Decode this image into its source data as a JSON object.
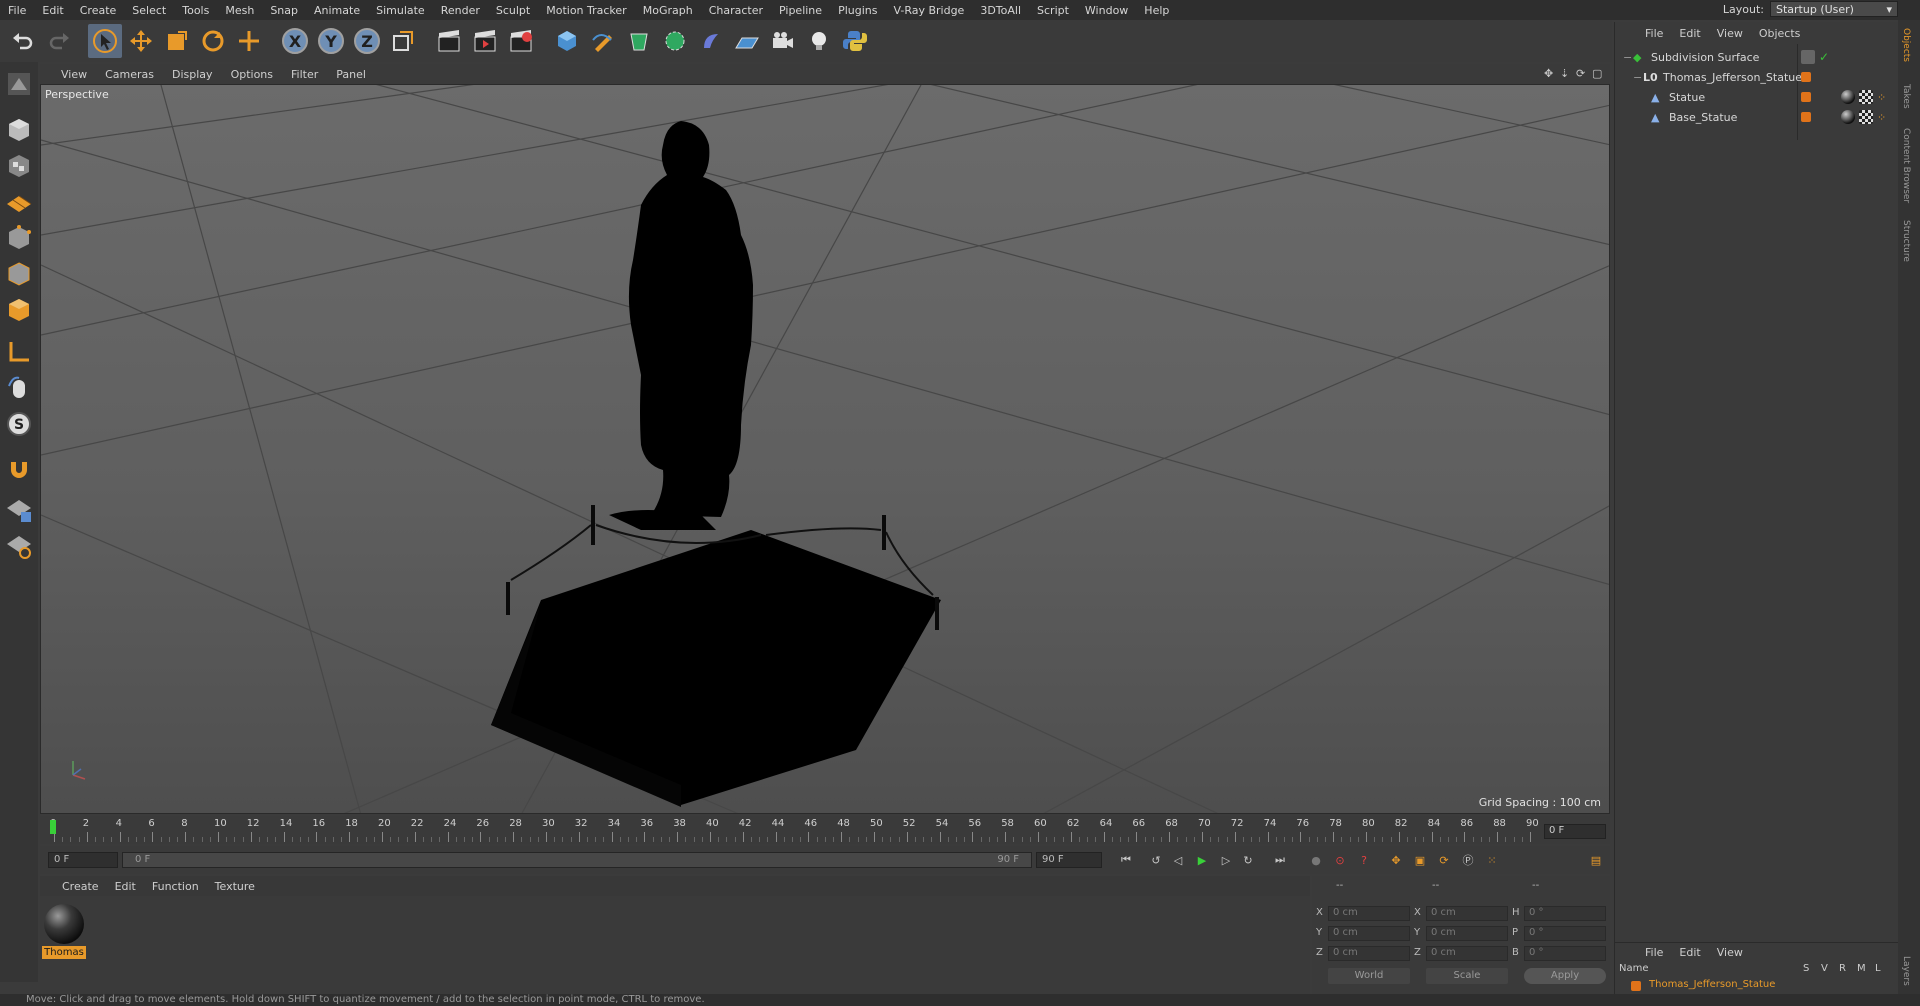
{
  "menubar": [
    "File",
    "Edit",
    "Create",
    "Select",
    "Tools",
    "Mesh",
    "Snap",
    "Animate",
    "Simulate",
    "Render",
    "Sculpt",
    "Motion Tracker",
    "MoGraph",
    "Character",
    "Pipeline",
    "Plugins",
    "V-Ray Bridge",
    "3DToAll",
    "Script",
    "Window",
    "Help"
  ],
  "layout": {
    "label": "Layout:",
    "value": "Startup (User)"
  },
  "viewport": {
    "menu": [
      "View",
      "Cameras",
      "Display",
      "Options",
      "Filter",
      "Panel"
    ],
    "camera_label": "Perspective",
    "grid_spacing": "Grid Spacing : 100 cm"
  },
  "timeline": {
    "ticks": [
      "0",
      "2",
      "4",
      "6",
      "8",
      "10",
      "12",
      "14",
      "16",
      "18",
      "20",
      "22",
      "24",
      "26",
      "28",
      "30",
      "32",
      "34",
      "36",
      "38",
      "40",
      "42",
      "44",
      "46",
      "48",
      "50",
      "52",
      "54",
      "56",
      "58",
      "60",
      "62",
      "64",
      "66",
      "68",
      "70",
      "72",
      "74",
      "76",
      "78",
      "80",
      "82",
      "84",
      "86",
      "88",
      "90"
    ],
    "current_frame": "0 F"
  },
  "transport": {
    "start_frame": "0 F",
    "range_start": "0 F",
    "range_end": "90 F",
    "end_frame": "90 F"
  },
  "material_manager": {
    "menu": [
      "Create",
      "Edit",
      "Function",
      "Texture"
    ],
    "materials": [
      {
        "name": "Thomas"
      }
    ]
  },
  "coordinates": {
    "header": [
      "--",
      "--",
      "--"
    ],
    "rows": [
      {
        "axis": "X",
        "pos": "0 cm",
        "axis2": "X",
        "size": "0 cm",
        "axis3": "H",
        "rot": "0 °"
      },
      {
        "axis": "Y",
        "pos": "0 cm",
        "axis2": "Y",
        "size": "0 cm",
        "axis3": "P",
        "rot": "0 °"
      },
      {
        "axis": "Z",
        "pos": "0 cm",
        "axis2": "Z",
        "size": "0 cm",
        "axis3": "B",
        "rot": "0 °"
      }
    ],
    "mode_world": "World",
    "mode_scale": "Scale",
    "apply": "Apply"
  },
  "status_text": "Move: Click and drag to move elements. Hold down SHIFT to quantize movement / add to the selection in point mode, CTRL to remove.",
  "object_manager": {
    "menu": [
      "File",
      "Edit",
      "View",
      "Objects"
    ],
    "objects": [
      {
        "name": "Subdivision Surface"
      },
      {
        "name": "Thomas_Jefferson_Statue"
      },
      {
        "name": "Statue"
      },
      {
        "name": "Base_Statue"
      }
    ]
  },
  "attribute_manager": {
    "menu": [
      "File",
      "Edit",
      "View"
    ],
    "columns": [
      "Name",
      "S",
      "V",
      "R",
      "M",
      "L"
    ],
    "rows": [
      {
        "name": "Thomas_Jefferson_Statue"
      }
    ]
  },
  "right_tabs": [
    "Objects",
    "Takes",
    "Content Browser",
    "Structure",
    "Layers"
  ],
  "colors": {
    "accent": "#e89a2a",
    "selected_tool": "#5b6b80",
    "check_green": "#38c038"
  }
}
